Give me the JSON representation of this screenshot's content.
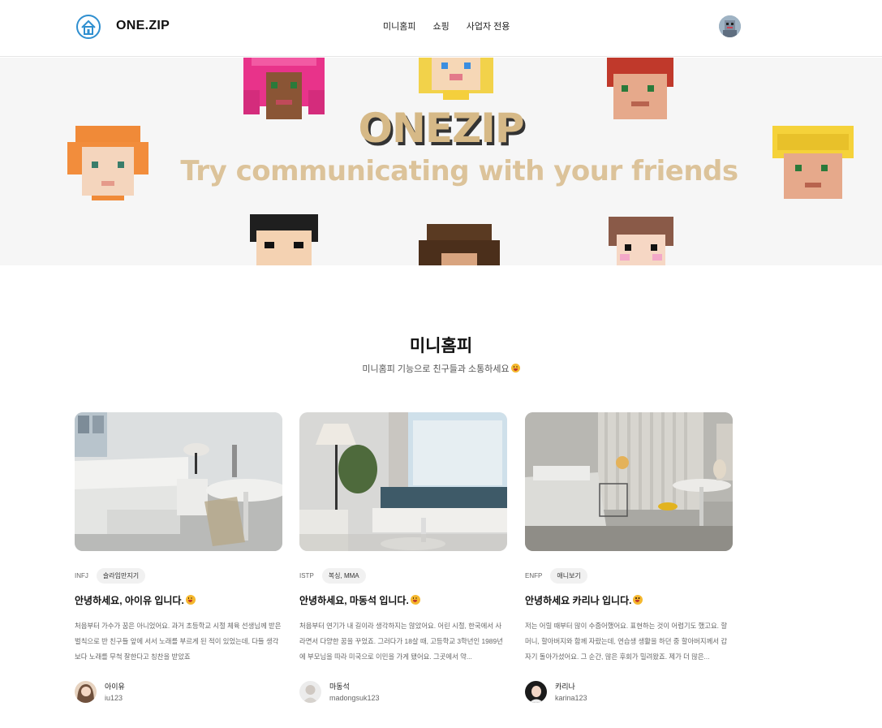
{
  "header": {
    "brand": "ONE.ZIP",
    "logo_icon": "house-icon",
    "nav": [
      "미니홈피",
      "쇼핑",
      "사업자 전용"
    ],
    "profile_icon": "user-avatar"
  },
  "banner": {
    "title": "ONEZIP",
    "subtitle": "Try communicating with your friends"
  },
  "section": {
    "title": "미니홈피",
    "subtitle": "미니홈피 기능으로 친구들과 소통하세요"
  },
  "cards": [
    {
      "mbti": "INFJ",
      "hobby": "슬라임만지기",
      "title": "안녕하세요, 아이유 입니다.",
      "desc": "처음부터 가수가 꿈은 아니었어요. 과거 초등학교 시절 체육 선생님께 받은 벌칙으로 반 친구들 앞에 서서 노래를 부르게 된 적이 있었는데, 다들 생각보다 노래를 무척 잘한다고 칭찬을 받았죠",
      "author_name": "아이유",
      "author_id": "iu123"
    },
    {
      "mbti": "ISTP",
      "hobby": "복싱, MMA",
      "title": "안녕하세요, 마동석 입니다.",
      "desc": "처음부터 연기가 내 길이라 생각하지는 않았어요. 어린 시절, 한국에서 사라면서 다양한 꿈을 꾸었죠. 그러다가 18살 때, 고등학교 3학년인 1989년에 부모님을 따라 미국으로 이민을 가게 됐어요. 그곳에서 약...",
      "author_name": "마동석",
      "author_id": "madongsuk123"
    },
    {
      "mbti": "ENFP",
      "hobby": "애니보기",
      "title": "안녕하세요 카리나 입니다.",
      "desc": "저는 어릴 때부터 많이 수줍어했어요. 표현하는 것이 어렵기도 했고요. 할머니, 할아버지와 함께 자랐는데, 연습생 생활을 하던 중 할아버지께서 갑자기 돌아가셨어요. 그 순간, 많은 후회가 밀려왔죠. 제가 더 많은...",
      "author_name": "카리나",
      "author_id": "karina123"
    }
  ]
}
